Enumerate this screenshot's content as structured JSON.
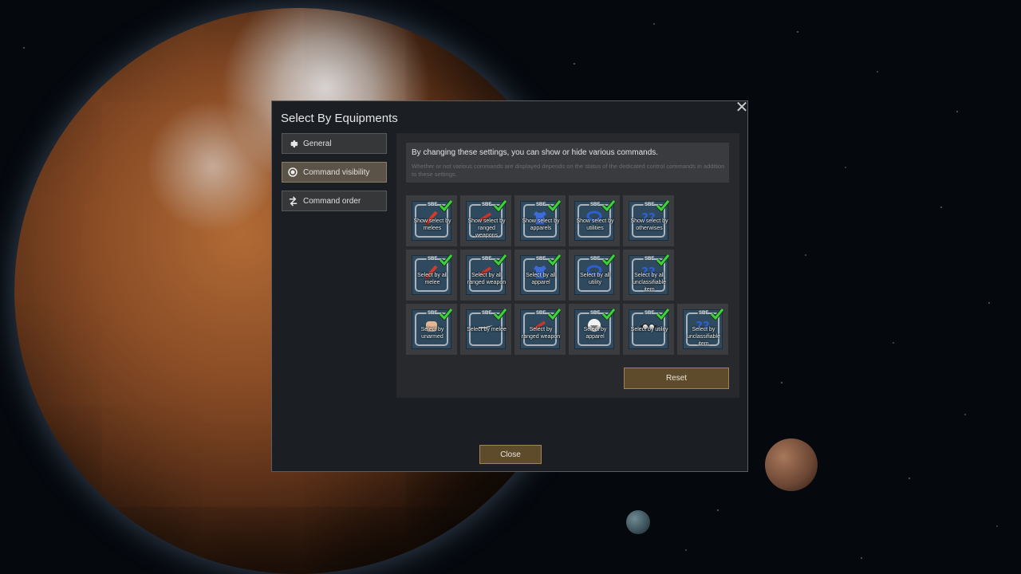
{
  "dialog": {
    "title": "Select By Equipments",
    "close_icon": "close-icon",
    "close_label": "Close"
  },
  "nav": {
    "items": [
      {
        "label": "General",
        "icon": "gear-icon",
        "active": false
      },
      {
        "label": "Command visibility",
        "icon": "radio-icon",
        "active": true
      },
      {
        "label": "Command order",
        "icon": "reorder-icon",
        "active": false
      }
    ]
  },
  "info": {
    "main": "By changing these settings, you can show or hide various commands.",
    "sub": "Whether or not various commands are displayed depends on the status of the dedicated control commands in addition to these settings."
  },
  "tiles": {
    "badge": "SBE",
    "row1": [
      {
        "label": "Show select by melees",
        "icon": "melee-sword-icon"
      },
      {
        "label": "Show select by ranged weapons",
        "icon": "ranged-weapon-icon"
      },
      {
        "label": "Show select by apparels",
        "icon": "apparel-shirt-icon"
      },
      {
        "label": "Show select by utilities",
        "icon": "utility-belt-icon"
      },
      {
        "label": "Show select by otherwises",
        "icon": "question-icon"
      }
    ],
    "row2": [
      {
        "label": "Select by all melee",
        "icon": "melee-sword-icon"
      },
      {
        "label": "Select by all ranged weapon",
        "icon": "ranged-weapon-icon"
      },
      {
        "label": "Select by all apparel",
        "icon": "apparel-shirt-icon"
      },
      {
        "label": "Select by all utility",
        "icon": "utility-belt-icon"
      },
      {
        "label": "Select by all unclassifiable item",
        "icon": "question-icon"
      }
    ],
    "row3": [
      {
        "label": "Select by unarmed",
        "icon": "fist-icon"
      },
      {
        "label": "Select by melee",
        "icon": "knife-icon"
      },
      {
        "label": "Select by ranged weapon",
        "icon": "ranged-weapon-icon"
      },
      {
        "label": "Select by apparel",
        "icon": "helmet-icon"
      },
      {
        "label": "Select by utility",
        "icon": "goggles-icon"
      },
      {
        "label": "Select by unclassifiable item",
        "icon": "question-icon"
      }
    ]
  },
  "reset_label": "Reset",
  "colors": {
    "accent_button": "#5e4b2c",
    "check": "#3fcf3f",
    "tile_bg": "#2f4a5e"
  }
}
